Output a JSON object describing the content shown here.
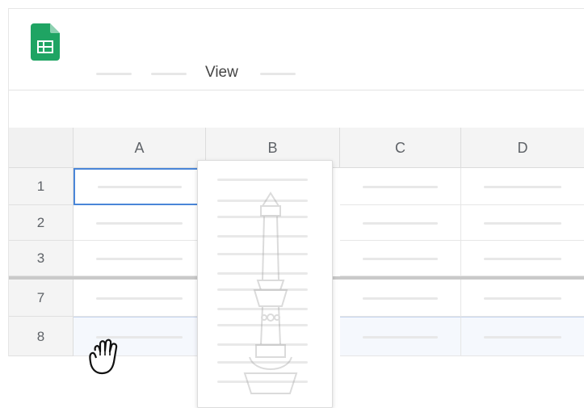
{
  "menubar": {
    "items": [
      {
        "label": ""
      },
      {
        "label": ""
      },
      {
        "label": "View"
      },
      {
        "label": ""
      }
    ]
  },
  "grid": {
    "columns": [
      "A",
      "B",
      "C",
      "D"
    ],
    "rows": [
      "1",
      "2",
      "3",
      "7",
      "8"
    ]
  },
  "icons": {
    "app_logo": "google-sheets-icon",
    "cursor": "grab-hand-icon",
    "watermark": "emblem-watermark"
  },
  "colors": {
    "sheets_green": "#1fa463",
    "selection_blue": "#4a86d8"
  }
}
